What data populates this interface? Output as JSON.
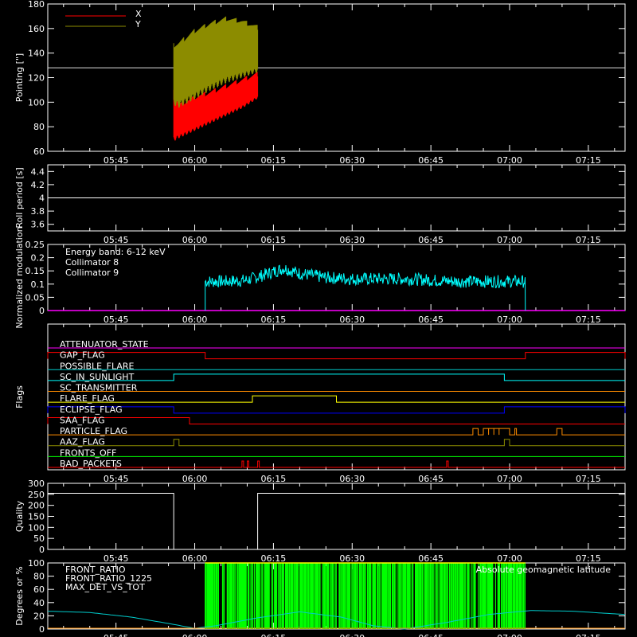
{
  "time_ticks": [
    "05:45",
    "06:00",
    "06:15",
    "06:30",
    "06:45",
    "07:00",
    "07:15"
  ],
  "colors": {
    "background": "#000000",
    "axes": "#ffffff",
    "red": "#ff0000",
    "olive": "#8c8c00",
    "cyan": "#00ffff",
    "magenta": "#ff00ff",
    "green": "#00ff00",
    "yellow": "#ffff00",
    "orange": "#ff8c00",
    "blue": "#0000ff"
  },
  "chart_data": [
    {
      "id": "pointing",
      "type": "line",
      "ylabel": "Pointing [\"]",
      "ylim": [
        60,
        180
      ],
      "yticks": [
        60,
        80,
        100,
        120,
        140,
        160,
        180
      ],
      "xlim": [
        "05:32",
        "07:22"
      ],
      "legend": [
        {
          "name": "X",
          "color": "#ff0000"
        },
        {
          "name": "Y",
          "color": "#8c8c00"
        }
      ],
      "reference_line": 128,
      "series": [
        {
          "name": "X",
          "color": "#ff0000",
          "x": [
            "05:56",
            "05:57",
            "06:00",
            "06:03",
            "06:06",
            "06:09",
            "06:12"
          ],
          "min": [
            70,
            72,
            78,
            84,
            90,
            96,
            104
          ],
          "max": [
            110,
            100,
            106,
            110,
            115,
            120,
            125
          ]
        },
        {
          "name": "Y",
          "color": "#8c8c00",
          "x": [
            "05:56",
            "05:57",
            "06:00",
            "06:03",
            "06:06",
            "06:09",
            "06:12"
          ],
          "min": [
            100,
            98,
            105,
            112,
            118,
            122,
            126
          ],
          "max": [
            148,
            150,
            160,
            166,
            170,
            168,
            163
          ]
        }
      ]
    },
    {
      "id": "roll_period",
      "type": "line",
      "ylabel": "Roll period [s]",
      "ylim": [
        3.5,
        4.5
      ],
      "yticks": [
        3.6,
        3.8,
        4.0,
        4.2,
        4.4
      ],
      "series": [
        {
          "x": [
            "05:32",
            "07:22"
          ],
          "y": [
            4.0,
            4.0
          ],
          "color": "#ffffff"
        }
      ]
    },
    {
      "id": "modulation",
      "type": "line",
      "ylabel": "Normalized modulation",
      "ylim": [
        0,
        0.25
      ],
      "yticks": [
        0.0,
        0.05,
        0.1,
        0.15,
        0.2,
        0.25
      ],
      "annotation": "Energy band: 6-12 keV",
      "legend": [
        {
          "name": "Collimator 8",
          "color": "#00ffff"
        },
        {
          "name": "Collimator 9",
          "color": "#ff00ff"
        }
      ],
      "series": [
        {
          "name": "Collimator 8",
          "color": "#00ffff",
          "x_range": [
            "06:02",
            "07:03"
          ],
          "x": [
            "06:02",
            "06:06",
            "06:10",
            "06:14",
            "06:17",
            "06:20",
            "06:25",
            "06:30",
            "06:40",
            "06:50",
            "07:00",
            "07:03"
          ],
          "y": [
            0.11,
            0.11,
            0.115,
            0.14,
            0.16,
            0.14,
            0.125,
            0.12,
            0.12,
            0.11,
            0.11,
            0.11
          ],
          "spread": 0.03
        },
        {
          "name": "Collimator 9",
          "color": "#ff00ff",
          "x": [
            "05:32",
            "07:22"
          ],
          "y": [
            0.0,
            0.0
          ]
        }
      ]
    },
    {
      "id": "flags",
      "type": "line",
      "ylabel": "Flags",
      "rows": [
        {
          "name": "ATTENUATOR_STATE",
          "color": "#ff00ff",
          "high": []
        },
        {
          "name": "SAA_FLAG_GAP",
          "label": "GAP_FLAG",
          "color": "#ff0000",
          "high": [
            [
              "05:32",
              "06:02"
            ],
            [
              "07:03",
              "07:22"
            ]
          ]
        },
        {
          "name": "POSSIBLE_FLARE",
          "color": "#00cccc",
          "high": []
        },
        {
          "name": "SC_IN_SUNLIGHT",
          "color": "#00ffff",
          "high": [
            [
              "05:56",
              "06:59"
            ]
          ]
        },
        {
          "name": "SC_TRANSMITTER",
          "color": "#ff8c00",
          "high": []
        },
        {
          "name": "FLARE_FLAG",
          "color": "#ffff00",
          "high": [
            [
              "06:11",
              "06:27"
            ]
          ]
        },
        {
          "name": "ECLIPSE_FLAG",
          "color": "#0000ff",
          "high": [
            [
              "05:32",
              "05:56"
            ],
            [
              "06:59",
              "07:22"
            ]
          ]
        },
        {
          "name": "SAA_FLAG",
          "color": "#ff0000",
          "high": [
            [
              "05:32",
              "05:59"
            ]
          ]
        },
        {
          "name": "PARTICLE_FLAG",
          "color": "#ff8c00",
          "high": [
            [
              "06:53",
              "06:54"
            ],
            [
              "06:55",
              "06:56"
            ],
            [
              "06:56",
              "06:57"
            ],
            [
              "06:57",
              "06:58"
            ],
            [
              "06:58",
              "07:00"
            ],
            [
              "07:01",
              "07:01"
            ],
            [
              "07:09",
              "07:10"
            ]
          ]
        },
        {
          "name": "AAZ_FLAG",
          "color": "#8c8c00",
          "high": [
            [
              "05:56",
              "05:57"
            ],
            [
              "06:59",
              "07:00"
            ]
          ]
        },
        {
          "name": "FRONTS_OFF",
          "color": "#00ff00",
          "high": []
        },
        {
          "name": "BAD_PACKETS",
          "color": "#ff0000",
          "high": [
            [
              "06:09",
              "06:09"
            ],
            [
              "06:10",
              "06:10"
            ],
            [
              "06:10",
              "06:10"
            ],
            [
              "06:12",
              "06:12"
            ],
            [
              "06:48",
              "06:48"
            ]
          ]
        }
      ]
    },
    {
      "id": "quality",
      "type": "line",
      "ylabel": "Quality",
      "ylim": [
        0,
        300
      ],
      "yticks": [
        0,
        50,
        100,
        150,
        200,
        250,
        300
      ],
      "series": [
        {
          "color": "#ffffff",
          "x": [
            "05:32",
            "05:56",
            "05:56",
            "06:12",
            "06:12",
            "07:22"
          ],
          "y": [
            255,
            255,
            0,
            0,
            255,
            255
          ]
        }
      ]
    },
    {
      "id": "ratios",
      "type": "line",
      "ylabel": "Degrees or %",
      "ylim": [
        0,
        100
      ],
      "yticks": [
        0,
        20,
        40,
        60,
        80,
        100
      ],
      "legend": [
        {
          "name": "FRONT_RATIO",
          "color": "#ffff00"
        },
        {
          "name": "FRONT_RATIO_1225",
          "color": "#00ff00"
        },
        {
          "name": "MAX_DET_VS_TOT",
          "color": "#ff8c00"
        }
      ],
      "annotation": "Absolute geomagnetic latitude",
      "series": [
        {
          "name": "FRONT_RATIO_1225",
          "color": "#00ff00",
          "x_range": [
            "06:02",
            "07:03"
          ],
          "y": 100
        },
        {
          "name": "FRONT_RATIO",
          "color": "#ffff00",
          "x_range": [
            "06:02",
            "07:03"
          ],
          "y": 100
        },
        {
          "name": "Absolute geomagnetic latitude",
          "color": "#00cccc",
          "x": [
            "05:32",
            "05:40",
            "05:48",
            "05:56",
            "06:00",
            "06:04",
            "06:12",
            "06:20",
            "06:28",
            "06:34",
            "06:40",
            "06:48",
            "06:56",
            "07:04",
            "07:12",
            "07:22"
          ],
          "y": [
            27,
            25,
            18,
            7,
            1,
            5,
            17,
            26,
            18,
            5,
            0,
            10,
            22,
            28,
            27,
            22
          ]
        },
        {
          "name": "MAX_DET_VS_TOT",
          "color": "#ff8c00",
          "x": [
            "05:32",
            "07:22"
          ],
          "y": [
            0,
            0
          ]
        }
      ]
    }
  ]
}
